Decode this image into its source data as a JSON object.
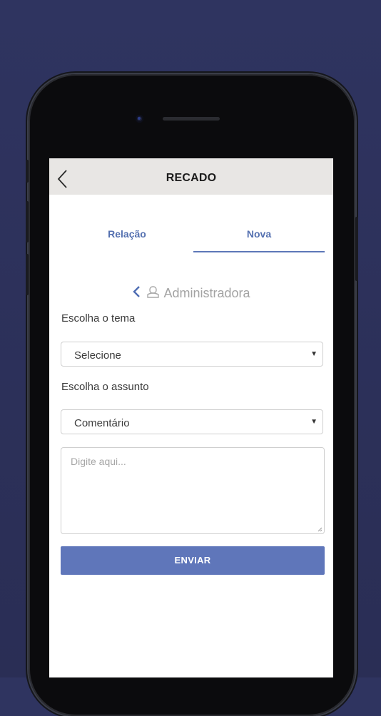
{
  "app_bar": {
    "title": "RECADO",
    "back_icon": "chevron-left-icon"
  },
  "tabs": [
    {
      "label": "Relação",
      "selected": false
    },
    {
      "label": "Nova",
      "selected": true
    }
  ],
  "company": {
    "name": "Administradora",
    "back_icon": "chevron-left-icon",
    "icon": "building-icon"
  },
  "form": {
    "theme_label": "Escolha o tema",
    "theme_value": "Selecione",
    "subject_label": "Escolha o assunto",
    "subject_value": "Comentário",
    "message_placeholder": "Digite aqui...",
    "submit_label": "ENVIAR"
  },
  "colors": {
    "background": "#2f3460",
    "accent": "#5f76ba",
    "tab_text": "#5470b0",
    "app_bar": "#e8e6e4"
  }
}
